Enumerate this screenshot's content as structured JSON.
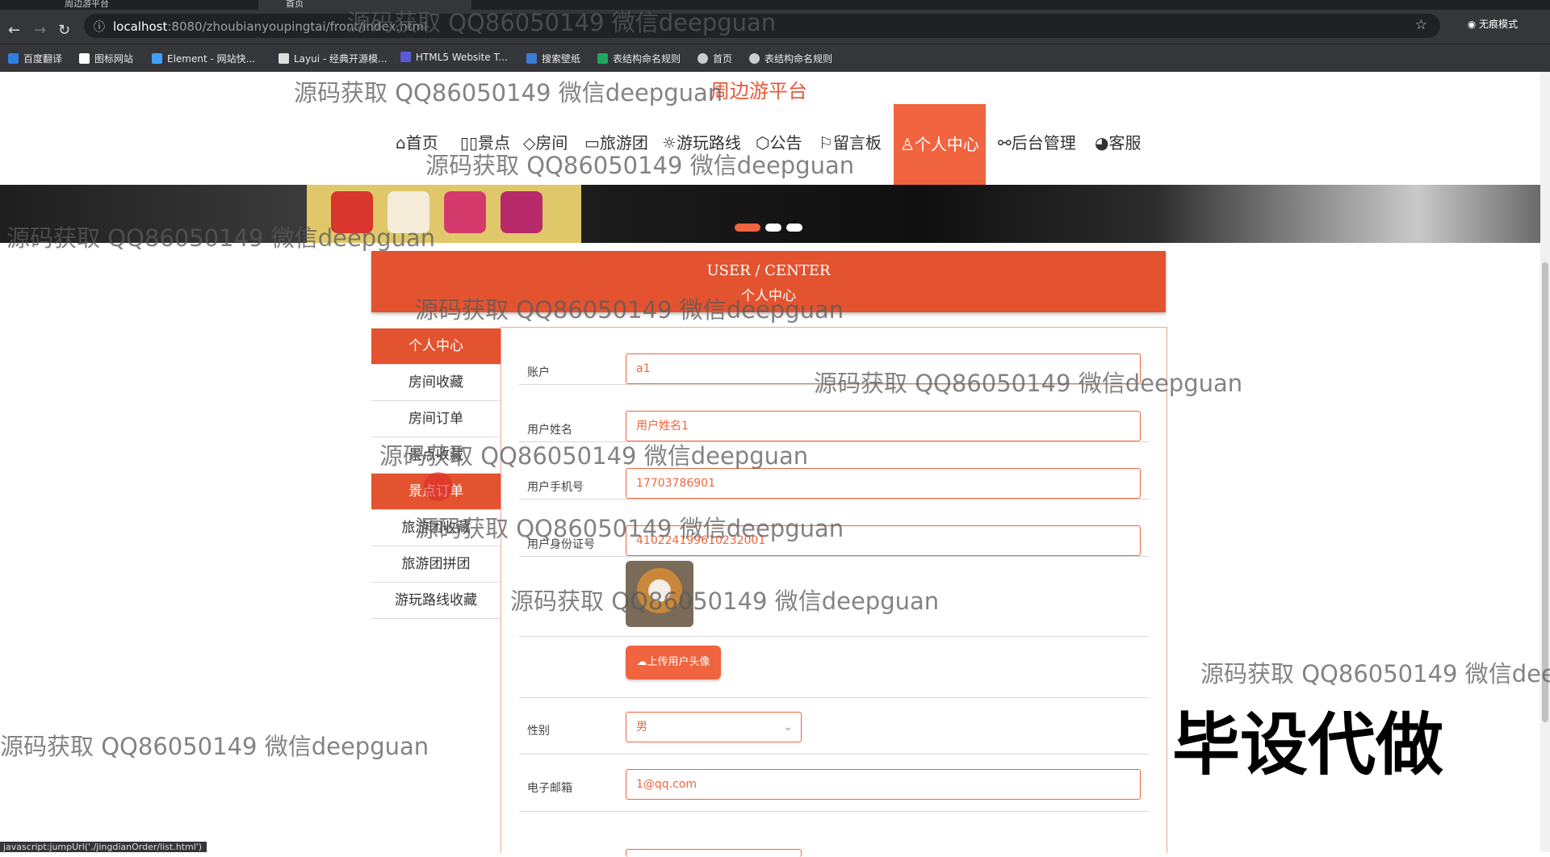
{
  "browser": {
    "tabs": [
      {
        "label": "周边游平台"
      },
      {
        "label": "首页"
      }
    ],
    "url_host": "localhost",
    "url_path": ":8080/zhoubianyoupingtai/front/index.html",
    "incognito_label": "无痕模式",
    "bookmarks": [
      {
        "label": "百度翻译",
        "color": "#2f7de1"
      },
      {
        "label": "图标网站",
        "color": "#ffffff"
      },
      {
        "label": "Element - 网站快...",
        "color": "#409eff"
      },
      {
        "label": "Layui - 经典开源模...",
        "color": "#dddddd"
      },
      {
        "label": "HTML5 Website T...",
        "color": "#5b5bd6"
      },
      {
        "label": "搜索壁纸",
        "color": "#3b7bd4"
      },
      {
        "label": "表结构命名规则",
        "color": "#1fa463"
      },
      {
        "label": "首页",
        "color": "#cccccc"
      },
      {
        "label": "表结构命名规则",
        "color": "#cccccc"
      }
    ],
    "status_text": "javascript:jumpUrl('./jingdianOrder/list.html')"
  },
  "site": {
    "title": "周边游平台",
    "nav": [
      {
        "label": "首页",
        "icon": "⌂"
      },
      {
        "label": "景点",
        "icon": "▯▯"
      },
      {
        "label": "房间",
        "icon": "◇"
      },
      {
        "label": "旅游团",
        "icon": "▭"
      },
      {
        "label": "游玩路线",
        "icon": "☼"
      },
      {
        "label": "公告",
        "icon": "⬡"
      },
      {
        "label": "留言板",
        "icon": "⚐"
      },
      {
        "label": "个人中心",
        "icon": "♙"
      },
      {
        "label": "后台管理",
        "icon": "⚯"
      },
      {
        "label": "客服",
        "icon": "◕"
      }
    ]
  },
  "user_center": {
    "heading_en": "USER / CENTER",
    "heading_zh": "个人中心",
    "side_menu": [
      {
        "label": "个人中心"
      },
      {
        "label": "房间收藏"
      },
      {
        "label": "房间订单"
      },
      {
        "label": "景点收藏"
      },
      {
        "label": "景点订单"
      },
      {
        "label": "旅游团收藏"
      },
      {
        "label": "旅游团拼团"
      },
      {
        "label": "游玩路线收藏"
      }
    ],
    "form": {
      "account_label": "账户",
      "account_value": "a1",
      "name_label": "用户姓名",
      "name_value": "用户姓名1",
      "phone_label": "用户手机号",
      "phone_value": "17703786901",
      "idcard_label": "用户身份证号",
      "idcard_value": "410224199610232001",
      "upload_label": "上传用户头像",
      "gender_label": "性别",
      "gender_value": "男",
      "email_label": "电子邮箱",
      "email_value": "1@qq.com"
    }
  },
  "watermarks": {
    "text": "源码获取 QQ86050149 微信deepguan",
    "big": "毕设代做"
  }
}
